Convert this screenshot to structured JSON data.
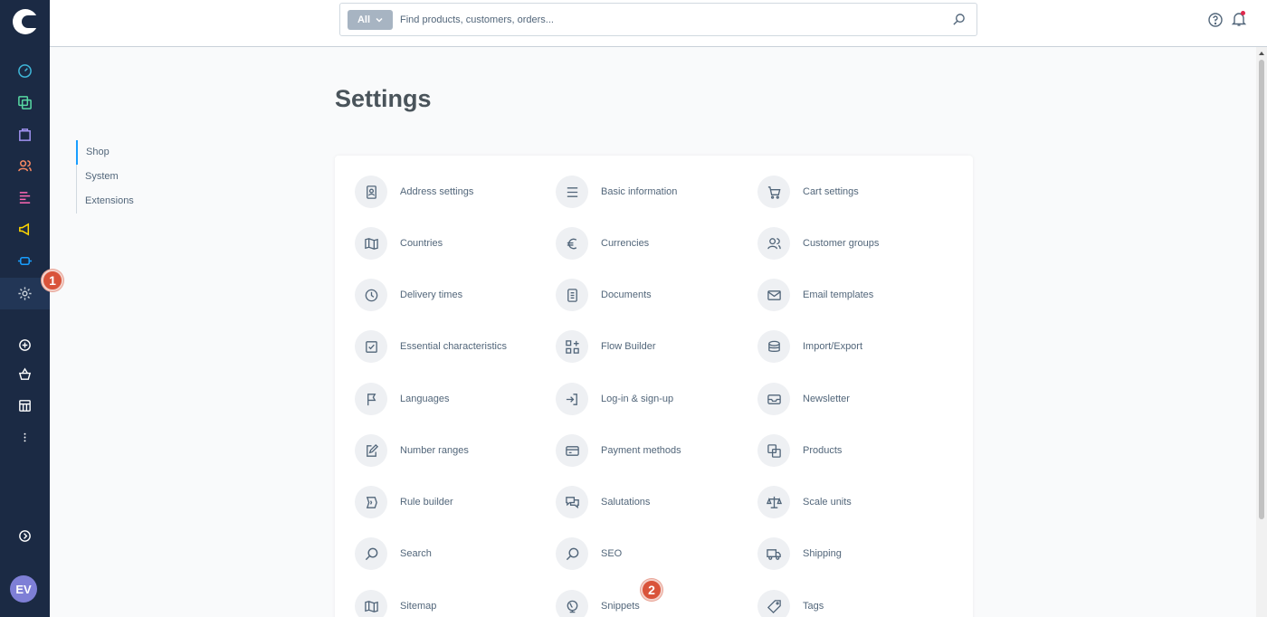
{
  "header": {
    "search_scope": "All",
    "search_placeholder": "Find products, customers, orders..."
  },
  "rail": {
    "avatar_initials": "EV"
  },
  "steps": {
    "first": "1",
    "second": "2"
  },
  "page": {
    "title": "Settings"
  },
  "subnav": {
    "items": [
      "Shop",
      "System",
      "Extensions"
    ]
  },
  "settings": {
    "tiles": [
      "Address settings",
      "Basic information",
      "Cart settings",
      "Countries",
      "Currencies",
      "Customer groups",
      "Delivery times",
      "Documents",
      "Email templates",
      "Essential characteristics",
      "Flow Builder",
      "Import/Export",
      "Languages",
      "Log-in & sign-up",
      "Newsletter",
      "Number ranges",
      "Payment methods",
      "Products",
      "Rule builder",
      "Salutations",
      "Scale units",
      "Search",
      "SEO",
      "Shipping",
      "Sitemap",
      "Snippets",
      "Tags"
    ]
  },
  "colors": {
    "rail_bg": "#1b2a44",
    "accent": "#189eff",
    "step_marker": "#d9533a",
    "tile_bg": "#eef0f3",
    "text": "#52667a"
  }
}
